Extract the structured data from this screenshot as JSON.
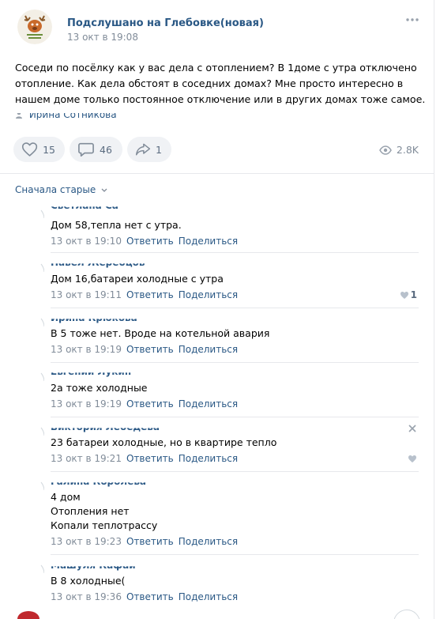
{
  "post": {
    "group_name": "Подслушано на Глебовке(новая)",
    "date": "13 окт в 19:08",
    "text": "Соседи по посёлку как у вас дела с отоплением? В 1доме с утра отключено отопление. Как дела обстоят в соседних домах? Мне просто интересно в нашем доме только постоянное отключение или в других домах тоже самое.",
    "author": "Ирина Сотникова",
    "likes": "15",
    "comments": "46",
    "shares": "1",
    "views": "2.8K",
    "icons": {
      "more": "more-dots-icon",
      "like": "heart-icon",
      "comment": "comment-icon",
      "share": "share-icon",
      "views": "eye-icon"
    }
  },
  "comments_section": {
    "sort_label": "Сначала старые"
  },
  "comment_actions": {
    "reply": "Ответить",
    "share": "Поделиться"
  },
  "comments": [
    {
      "author": "Светлана Са",
      "lines": [
        "Дом 58,тепла нет с утра."
      ],
      "date": "13 окт в 19:10",
      "likes": ""
    },
    {
      "author": "Павел Жеребцов",
      "lines": [
        "Дом 16,батареи холодные с утра"
      ],
      "date": "13 окт в 19:11",
      "likes": "1"
    },
    {
      "author": "Ирина Крюкова",
      "lines": [
        "В 5 тоже нет. Вроде на котельной авария"
      ],
      "date": "13 окт в 19:19",
      "likes": ""
    },
    {
      "author": "Евгений Лукин",
      "lines": [
        "2а тоже холодные"
      ],
      "date": "13 окт в 19:19",
      "likes": ""
    },
    {
      "author": "Виктория Лебедева",
      "lines": [
        "23 батареи холодные, но в квартире тепло"
      ],
      "date": "13 окт в 19:21",
      "likes": ""
    },
    {
      "author": "Галина Королева",
      "lines": [
        "4 дом",
        "Отопления нет",
        "Копали теплотрассу"
      ],
      "date": "13 окт в 19:23",
      "likes": ""
    },
    {
      "author": "Машуля Кафаи",
      "lines": [
        "В 8 холодные("
      ],
      "date": "13 окт в 19:36",
      "likes": ""
    }
  ],
  "colors": {
    "link": "#2a5885",
    "meta": "#818c99",
    "button_bg": "#f0f2f5"
  }
}
